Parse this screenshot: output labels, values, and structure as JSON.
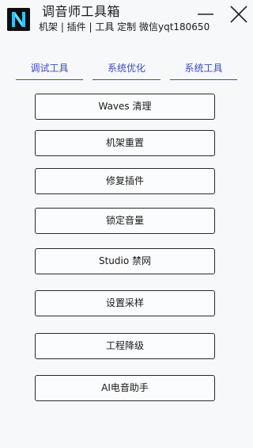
{
  "app": {
    "title": "调音师工具箱",
    "subtitle": "机架 | 插件 | 工具 定制 微信yqt180650",
    "logo_letter": "N"
  },
  "window_controls": {
    "minimize_icon": "minimize-icon",
    "close_icon": "close-icon"
  },
  "tabs": [
    {
      "label": "调试工具"
    },
    {
      "label": "系统优化"
    },
    {
      "label": "系统工具"
    }
  ],
  "buttons": [
    {
      "label": "Waves 清理"
    },
    {
      "label": "机架重置"
    },
    {
      "label": "修复插件"
    },
    {
      "label": "锁定音量"
    },
    {
      "label": "Studio 禁网"
    },
    {
      "label": "设置采样"
    },
    {
      "label": "工程降级"
    },
    {
      "label": "AI电音助手"
    }
  ],
  "colors": {
    "accent": "#3b4cc0",
    "logo_cyan": "#2ec4ff",
    "background": "#f7f8fa"
  }
}
